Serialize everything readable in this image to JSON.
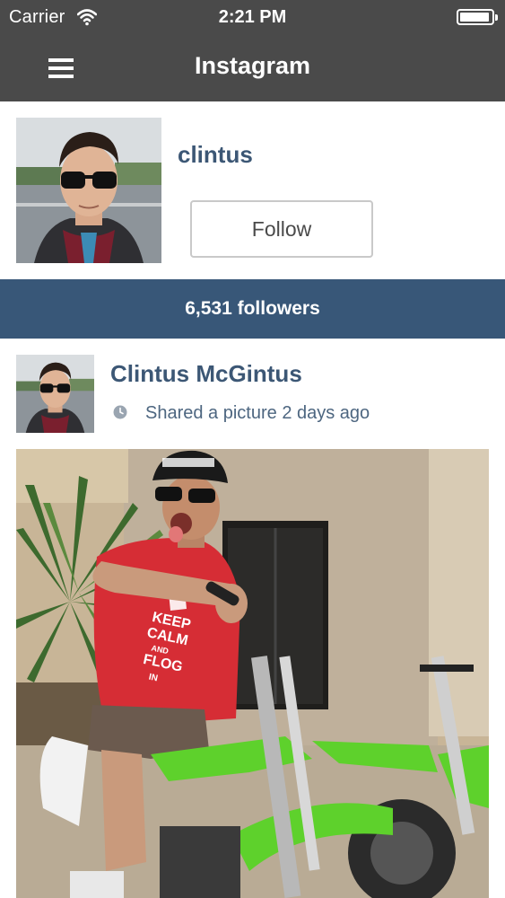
{
  "status_bar": {
    "carrier": "Carrier",
    "time": "2:21 PM",
    "battery_level": 0.95,
    "icons": [
      "wifi-icon",
      "battery-icon"
    ]
  },
  "nav": {
    "title": "Instagram",
    "menu_icon": "hamburger-menu-icon"
  },
  "profile": {
    "username": "clintus",
    "follow_label": "Follow",
    "followers_text": "6,531 followers"
  },
  "post": {
    "author": "Clintus McGintus",
    "meta": "Shared a picture 2 days ago",
    "meta_icon": "clock-icon",
    "shirt_text": [
      "KEEP",
      "CALM",
      "AND",
      "FLOG",
      "IN"
    ]
  },
  "colors": {
    "nav_background": "#4a4a4a",
    "accent_blue": "#385778",
    "link_blue": "#3c5775",
    "meta_gray": "#4d6680"
  }
}
